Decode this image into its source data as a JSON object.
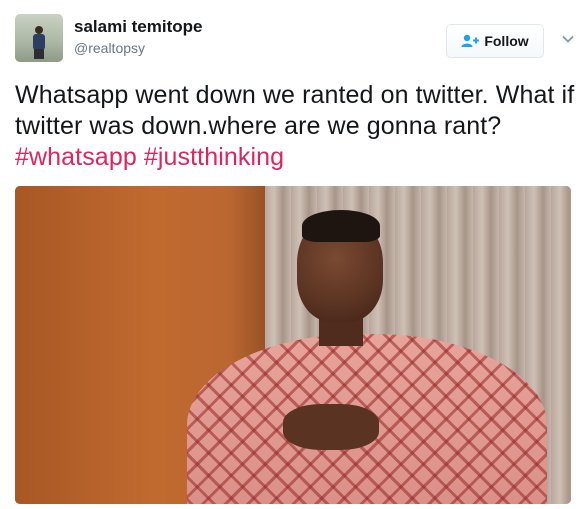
{
  "user": {
    "display_name": "salami temitope",
    "handle": "@realtopsy"
  },
  "follow_button": {
    "label": "Follow",
    "icon": "add-person-icon"
  },
  "menu": {
    "icon": "chevron-down-icon"
  },
  "tweet": {
    "text": "Whatsapp went down we ranted on twitter. What if twitter was down.where are we gonna rant?",
    "hashtags": [
      "#whatsapp",
      "#justthinking"
    ]
  },
  "colors": {
    "hashtag": "#e0245e",
    "follow_icon": "#1da1f2",
    "handle": "#657786"
  }
}
